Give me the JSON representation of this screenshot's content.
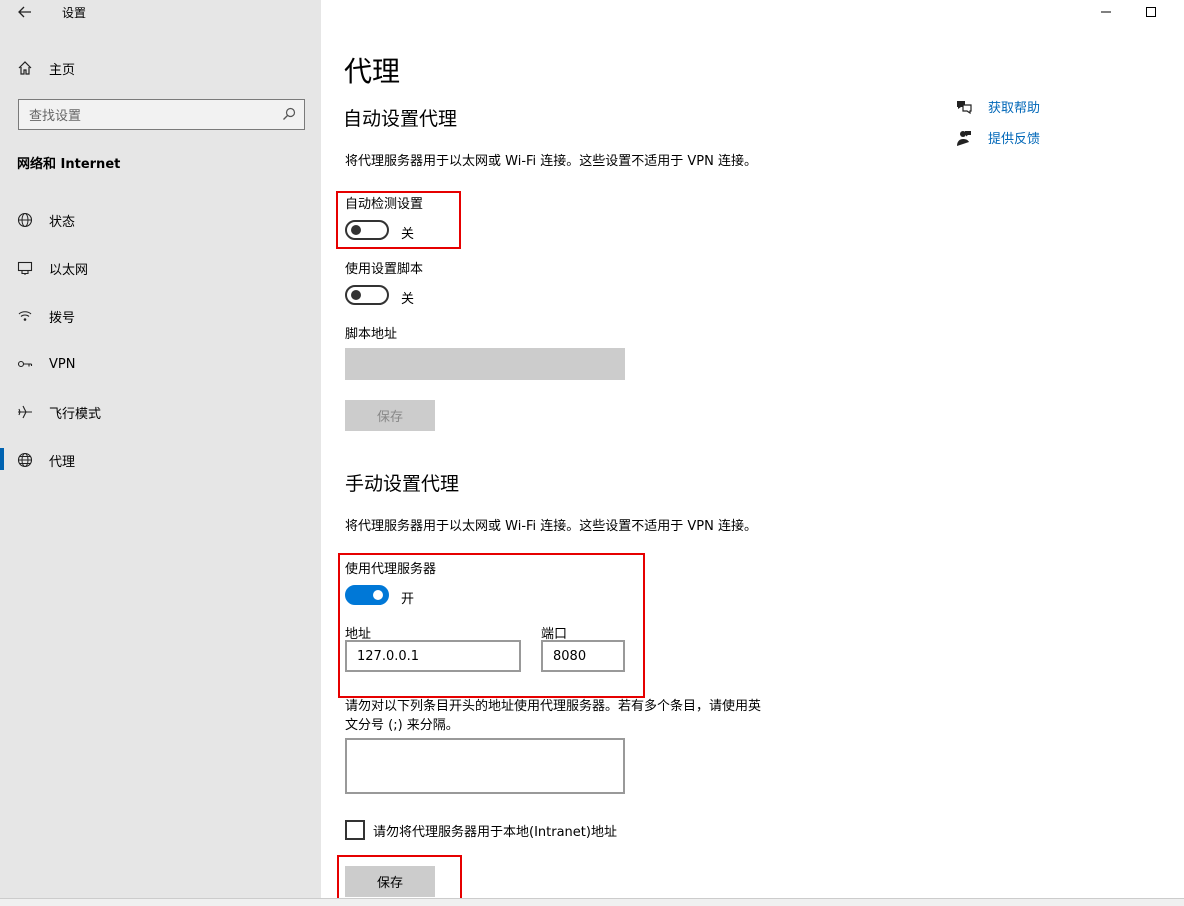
{
  "window": {
    "title": "设置"
  },
  "sidebar": {
    "home": "主页",
    "search_placeholder": "查找设置",
    "section_title": "网络和 Internet",
    "items": [
      {
        "label": "状态",
        "icon": "globe-status-icon"
      },
      {
        "label": "以太网",
        "icon": "ethernet-icon"
      },
      {
        "label": "拨号",
        "icon": "dialup-icon"
      },
      {
        "label": "VPN",
        "icon": "vpn-icon"
      },
      {
        "label": "飞行模式",
        "icon": "airplane-icon"
      },
      {
        "label": "代理",
        "icon": "globe-icon",
        "active": true
      }
    ]
  },
  "main": {
    "title": "代理",
    "auto": {
      "heading": "自动设置代理",
      "description": "将代理服务器用于以太网或 Wi-Fi 连接。这些设置不适用于 VPN 连接。",
      "detect_label": "自动检测设置",
      "detect_state": "关",
      "script_label": "使用设置脚本",
      "script_state": "关",
      "address_label": "脚本地址",
      "address_value": "",
      "save_label": "保存"
    },
    "manual": {
      "heading": "手动设置代理",
      "description": "将代理服务器用于以太网或 Wi-Fi 连接。这些设置不适用于 VPN 连接。",
      "use_proxy_label": "使用代理服务器",
      "use_proxy_state": "开",
      "address_label": "地址",
      "address_value": "127.0.0.1",
      "port_label": "端口",
      "port_value": "8080",
      "exceptions_text_line1": "请勿对以下列条目开头的地址使用代理服务器。若有多个条目，请使用英",
      "exceptions_text_line2": "文分号 (;) 来分隔。",
      "exceptions_value": "",
      "local_checkbox_label": "请勿将代理服务器用于本地(Intranet)地址",
      "save_label": "保存"
    }
  },
  "help": {
    "get_help": "获取帮助",
    "feedback": "提供反馈"
  },
  "colors": {
    "accent": "#0078d7",
    "link": "#0067b8",
    "highlight_box": "#e60000",
    "sidebar_bg": "#e6e6e6"
  }
}
